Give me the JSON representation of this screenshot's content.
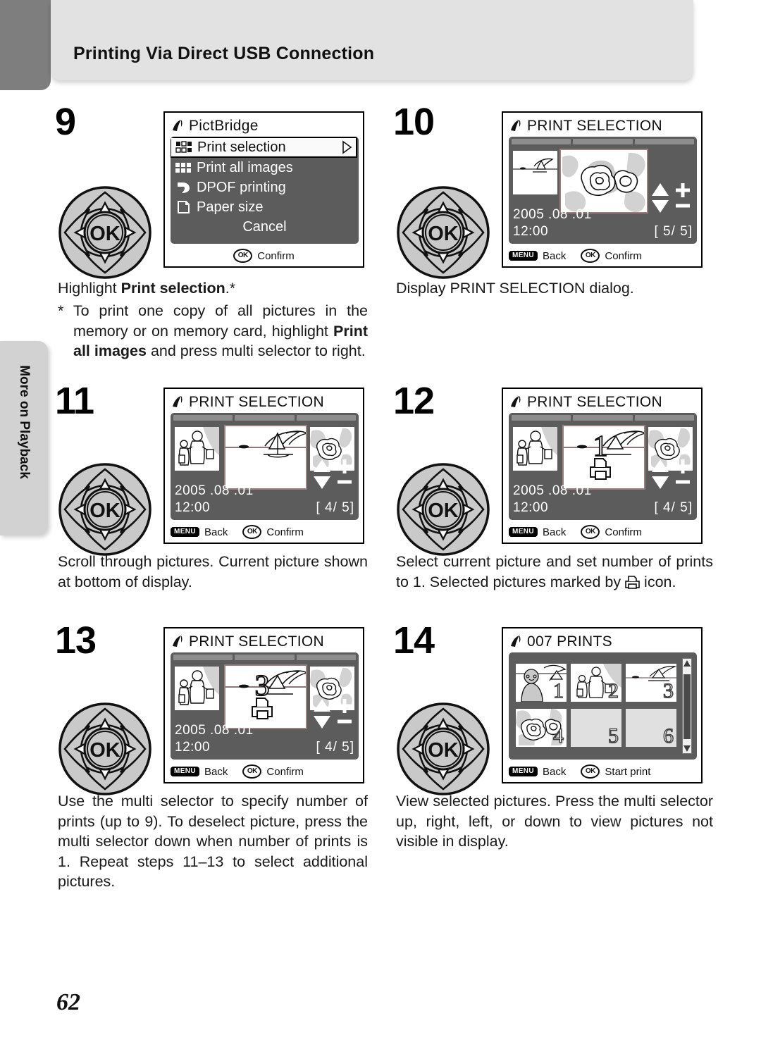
{
  "header": {
    "title": "Printing Via Direct USB Connection"
  },
  "side_tab": {
    "label": "More on Playback"
  },
  "page_number": "62",
  "icons": {
    "pictbridge": "pictbridge-icon",
    "printer": "printer-icon",
    "menu_button": "MENU",
    "ok_button": "OK"
  },
  "steps": [
    {
      "number": "9",
      "screen": {
        "type": "menu",
        "title": "PictBridge",
        "items": [
          {
            "label": "Print selection",
            "icon": "print-selection-icon",
            "selected": true
          },
          {
            "label": "Print all images",
            "icon": "print-all-images-icon",
            "selected": false
          },
          {
            "label": "DPOF printing",
            "icon": "dpof-icon",
            "selected": false
          },
          {
            "label": "Paper size",
            "icon": "paper-size-icon",
            "selected": false
          },
          {
            "label": "Cancel",
            "icon": "",
            "selected": false
          }
        ],
        "footer": [
          {
            "button": "OK",
            "label": "Confirm"
          }
        ]
      },
      "caption_main": "Highlight ",
      "caption_bold": "Print selection",
      "caption_tail": ".*",
      "caption_note_1": "* To print one copy of all pictures in the memory or on memory card, highlight ",
      "caption_note_bold": "Print all images",
      "caption_note_2": " and press multi selector to right."
    },
    {
      "number": "10",
      "screen": {
        "type": "print-selection",
        "title": "PRINT SELECTION",
        "date": "2005 .08 .01",
        "time": "12:00",
        "count": "[    5/    5]",
        "count_current": "5",
        "count_total": "5",
        "print_count": "",
        "thumb_left": "beach-scene",
        "thumb_main": "flowers-scene",
        "thumb_right": "",
        "footer": [
          {
            "button": "MENU",
            "label": "Back"
          },
          {
            "button": "OK",
            "label": "Confirm"
          }
        ]
      },
      "caption_main": "Display PRINT SELECTION dialog."
    },
    {
      "number": "11",
      "screen": {
        "type": "print-selection",
        "title": "PRINT SELECTION",
        "date": "2005 .08 .01",
        "time": "12:00",
        "count": "[    4/    5]",
        "count_current": "4",
        "count_total": "5",
        "print_count": "",
        "thumb_left": "family-scene",
        "thumb_main": "sailboat-scene",
        "thumb_right": "flowers-scene",
        "footer": [
          {
            "button": "MENU",
            "label": "Back"
          },
          {
            "button": "OK",
            "label": "Confirm"
          }
        ]
      },
      "caption_main": "Scroll through pictures. Current picture shown at bottom of display."
    },
    {
      "number": "12",
      "screen": {
        "type": "print-selection",
        "title": "PRINT SELECTION",
        "date": "2005 .08 .01",
        "time": "12:00",
        "count": "[    4/    5]",
        "count_current": "4",
        "count_total": "5",
        "print_count": "1",
        "thumb_left": "family-scene",
        "thumb_main": "sailboat-scene",
        "thumb_right": "flowers-scene",
        "footer": [
          {
            "button": "MENU",
            "label": "Back"
          },
          {
            "button": "OK",
            "label": "Confirm"
          }
        ]
      },
      "caption_main": "Select current picture and set number of prints to 1. Selected pictures marked by ",
      "caption_tail": " icon."
    },
    {
      "number": "13",
      "screen": {
        "type": "print-selection",
        "title": "PRINT SELECTION",
        "date": "2005 .08 .01",
        "time": "12:00",
        "count": "[    4/    5]",
        "count_current": "4",
        "count_total": "5",
        "print_count": "3",
        "thumb_left": "family-scene",
        "thumb_main": "sailboat-scene",
        "thumb_right": "flowers-scene",
        "footer": [
          {
            "button": "MENU",
            "label": "Back"
          },
          {
            "button": "OK",
            "label": "Confirm"
          }
        ]
      },
      "caption_main": "Use the multi selector to specify number of prints (up to 9). To deselect picture, press the multi selector down when number of prints is 1. Repeat steps 11–13 to select additional pictures."
    },
    {
      "number": "14",
      "screen": {
        "type": "prints-grid",
        "title": "007 PRINTS",
        "cells": [
          {
            "num": "1",
            "image": "portrait-scene"
          },
          {
            "num": "2",
            "image": "family-scene"
          },
          {
            "num": "3",
            "image": "beach-scene"
          },
          {
            "num": "4",
            "image": "flowers-scene"
          },
          {
            "num": "5",
            "image": ""
          },
          {
            "num": "6",
            "image": ""
          }
        ],
        "footer": [
          {
            "button": "MENU",
            "label": "Back"
          },
          {
            "button": "OK",
            "label": "Start print"
          }
        ]
      },
      "caption_main": "View selected pictures. Press the multi selector up, right, left, or down to view pictures not visible in display."
    }
  ]
}
